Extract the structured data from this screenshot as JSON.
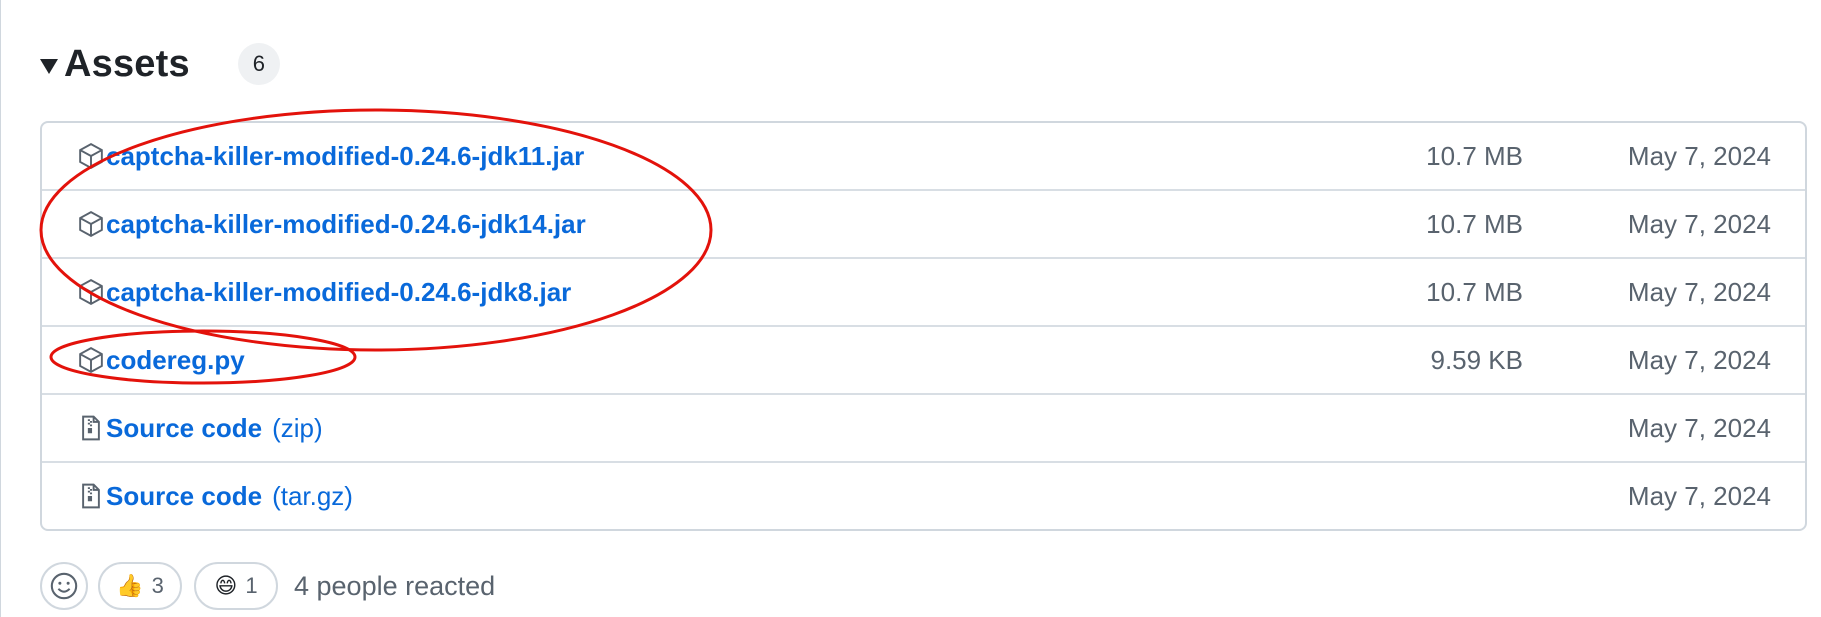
{
  "assets": {
    "title": "Assets",
    "count": "6",
    "rows": [
      {
        "name": "captcha-killer-modified-0.24.6-jdk11.jar",
        "ext": "",
        "size": "10.7 MB",
        "date": "May 7, 2024",
        "icon": "package-icon"
      },
      {
        "name": "captcha-killer-modified-0.24.6-jdk14.jar",
        "ext": "",
        "size": "10.7 MB",
        "date": "May 7, 2024",
        "icon": "package-icon"
      },
      {
        "name": "captcha-killer-modified-0.24.6-jdk8.jar",
        "ext": "",
        "size": "10.7 MB",
        "date": "May 7, 2024",
        "icon": "package-icon"
      },
      {
        "name": "codereg.py",
        "ext": "",
        "size": "9.59 KB",
        "date": "May 7, 2024",
        "icon": "package-icon"
      },
      {
        "name": "Source code",
        "ext": "(zip)",
        "size": "",
        "date": "May 7, 2024",
        "icon": "file-zip-icon"
      },
      {
        "name": "Source code",
        "ext": "(tar.gz)",
        "size": "",
        "date": "May 7, 2024",
        "icon": "file-zip-icon"
      }
    ]
  },
  "reactions": {
    "items": [
      {
        "emoji": "👍",
        "icon": "thumbs-up-icon",
        "count": "3"
      },
      {
        "emoji": "😄",
        "icon": "smile-emoji-icon",
        "count": "1"
      }
    ],
    "summary": "4 people reacted"
  },
  "colors": {
    "link": "#0969da",
    "muted": "#59636e",
    "border": "#d0d7de",
    "annotation": "#e3120b"
  }
}
